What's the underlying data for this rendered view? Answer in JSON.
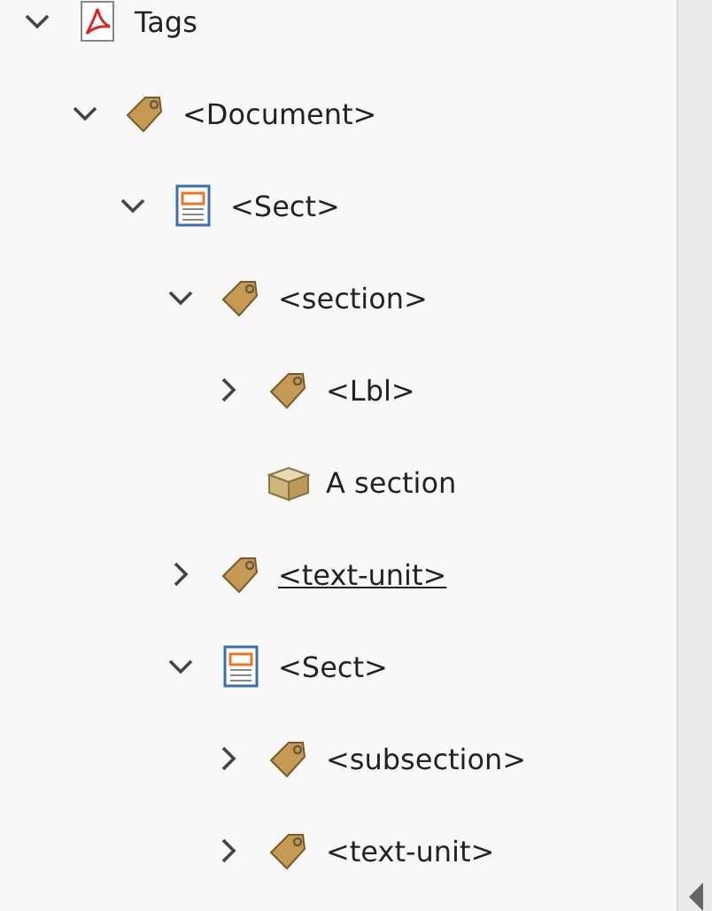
{
  "tree": [
    {
      "kind": "root",
      "label": "Tags",
      "expanded": true,
      "hovered": false,
      "children": [
        {
          "kind": "tag",
          "label": "<Document>",
          "expanded": true,
          "hovered": false,
          "children": [
            {
              "kind": "sect",
              "label": "<Sect>",
              "expanded": true,
              "hovered": false,
              "children": [
                {
                  "kind": "tag",
                  "label": "<section>",
                  "expanded": true,
                  "hovered": false,
                  "children": [
                    {
                      "kind": "tag",
                      "label": "<Lbl>",
                      "expanded": false,
                      "hovered": false
                    },
                    {
                      "kind": "content",
                      "label": "A section",
                      "hovered": false
                    }
                  ]
                },
                {
                  "kind": "tag",
                  "label": "<text-unit>",
                  "expanded": false,
                  "hovered": true
                },
                {
                  "kind": "sect",
                  "label": "<Sect>",
                  "expanded": true,
                  "hovered": false,
                  "children": [
                    {
                      "kind": "tag",
                      "label": "<subsection>",
                      "expanded": false,
                      "hovered": false
                    },
                    {
                      "kind": "tag",
                      "label": "<text-unit>",
                      "expanded": false,
                      "hovered": false
                    }
                  ]
                }
              ]
            }
          ]
        }
      ]
    }
  ]
}
